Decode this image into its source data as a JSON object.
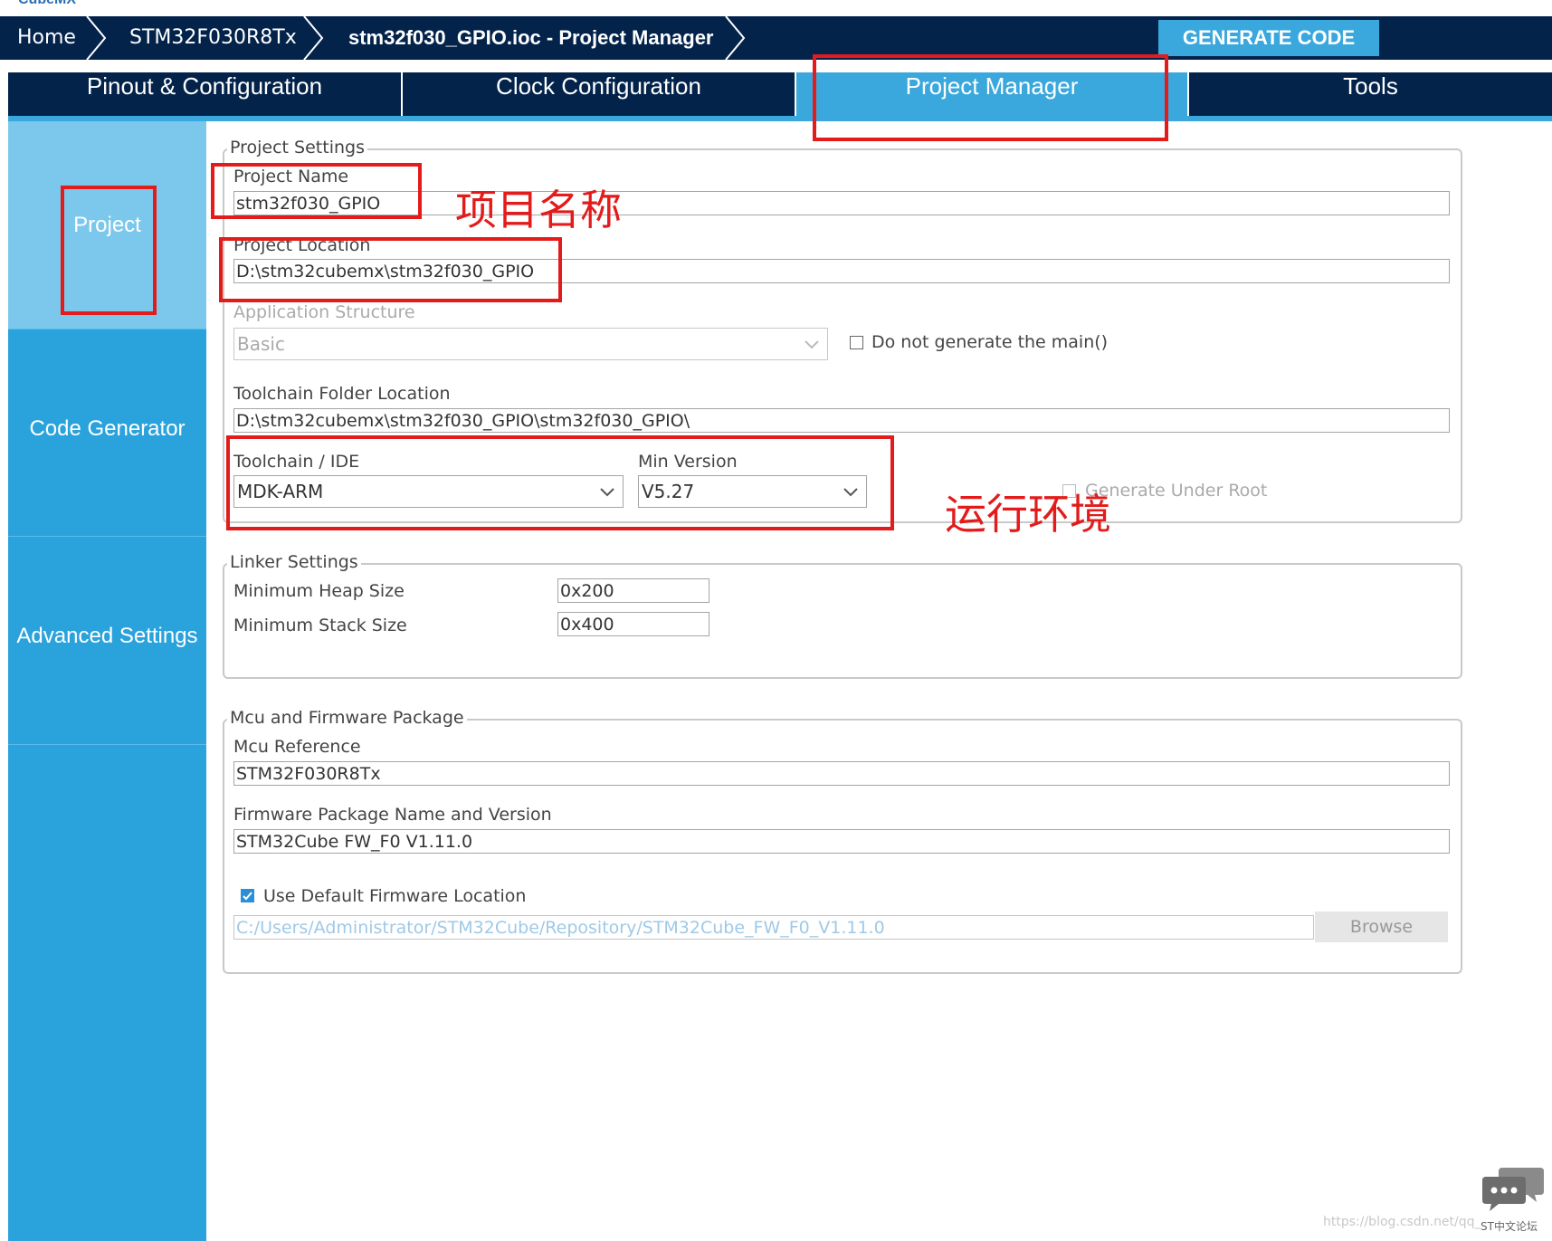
{
  "app": {
    "logo": "CubeMX"
  },
  "breadcrumb": {
    "items": [
      "Home",
      "STM32F030R8Tx",
      "stm32f030_GPIO.ioc - Project Manager"
    ]
  },
  "toolbar": {
    "generate_label": "GENERATE CODE"
  },
  "tabs": [
    {
      "label": "Pinout & Configuration"
    },
    {
      "label": "Clock Configuration"
    },
    {
      "label": "Project Manager",
      "active": true
    },
    {
      "label": "Tools"
    }
  ],
  "sidebar": {
    "items": [
      {
        "label": "Project",
        "active": true
      },
      {
        "label": "Code Generator"
      },
      {
        "label": "Advanced Settings"
      }
    ]
  },
  "project_settings": {
    "legend": "Project Settings",
    "name_label": "Project Name",
    "name_value": "stm32f030_GPIO",
    "location_label": "Project Location",
    "location_value": "D:\\stm32cubemx\\stm32f030_GPIO",
    "app_structure_label": "Application Structure",
    "app_structure_value": "Basic",
    "no_main_label": "Do not generate the main()",
    "toolchain_folder_label": "Toolchain Folder Location",
    "toolchain_folder_value": "D:\\stm32cubemx\\stm32f030_GPIO\\stm32f030_GPIO\\",
    "toolchain_label": "Toolchain / IDE",
    "toolchain_value": "MDK-ARM",
    "min_version_label": "Min Version",
    "min_version_value": "V5.27",
    "gen_under_root_label": "Generate Under Root"
  },
  "linker_settings": {
    "legend": "Linker Settings",
    "heap_label": "Minimum Heap Size",
    "heap_value": "0x200",
    "stack_label": "Minimum Stack Size",
    "stack_value": "0x400"
  },
  "mcu_firmware": {
    "legend": "Mcu and Firmware Package",
    "mcu_ref_label": "Mcu Reference",
    "mcu_ref_value": "STM32F030R8Tx",
    "fw_label": "Firmware Package Name and Version",
    "fw_value": "STM32Cube FW_F0 V1.11.0",
    "use_default_label": "Use Default Firmware Location",
    "use_default_checked": true,
    "fw_location_value": "C:/Users/Administrator/STM32Cube/Repository/STM32Cube_FW_F0_V1.11.0",
    "browse_label": "Browse"
  },
  "annotations": {
    "project_name_note": "项目名称",
    "toolchain_note": "运行环境",
    "color": "#e31b1b"
  },
  "watermark": {
    "url": "https://blog.csdn.net/qq_",
    "label": "ST中文论坛"
  },
  "colors": {
    "navy": "#03234b",
    "accent": "#3aa8dc",
    "sidebar": "#2aa2dc",
    "sidebar_active": "#7cc8ec"
  }
}
